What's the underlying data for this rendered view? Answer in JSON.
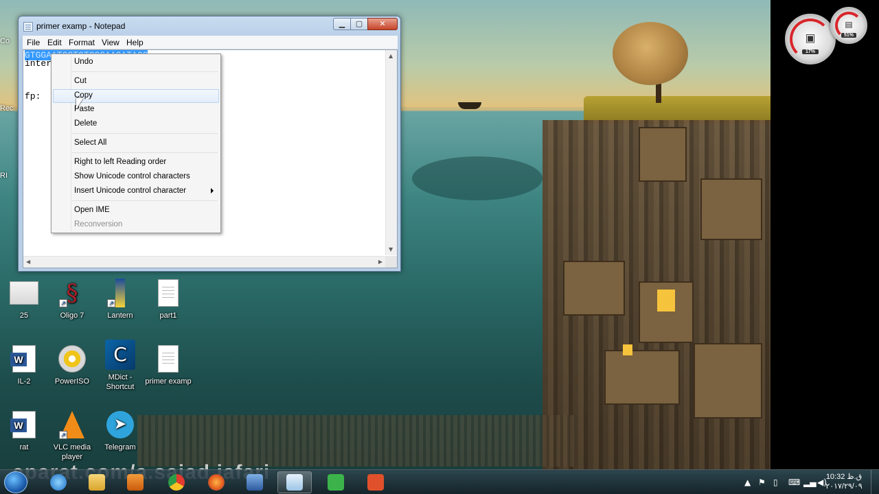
{
  "notepad": {
    "title": "primer examp - Notepad",
    "menu": [
      "File",
      "Edit",
      "Format",
      "View",
      "Help"
    ],
    "lines": [
      "GTGGAATGCTGTCGCAAGATAGG",
      "interf",
      "",
      "fp:  ~"
    ]
  },
  "context_menu": {
    "items": [
      {
        "label": "Undo"
      },
      {
        "label": "Cut"
      },
      {
        "label": "Copy",
        "highlighted": true
      },
      {
        "label": "Paste"
      },
      {
        "label": "Delete"
      },
      {
        "label": "Select All"
      },
      {
        "label": "Right to left Reading order"
      },
      {
        "label": "Show Unicode control characters"
      },
      {
        "label": "Insert Unicode control character",
        "submenu": true
      },
      {
        "label": "Open IME"
      },
      {
        "label": "Reconversion",
        "disabled": true
      }
    ]
  },
  "desktop_icons": [
    {
      "label": "25",
      "icon": "thumbnail-icon"
    },
    {
      "label": "Oligo 7",
      "icon": "oligo-icon"
    },
    {
      "label": "Lantern",
      "icon": "lantern-icon"
    },
    {
      "label": "part1",
      "icon": "text-file-icon"
    },
    {
      "label": "IL-2",
      "icon": "word-doc-icon"
    },
    {
      "label": "PowerISO",
      "icon": "poweriso-icon"
    },
    {
      "label": "MDict - Shortcut",
      "icon": "mdict-icon"
    },
    {
      "label": "primer examp",
      "icon": "text-file-icon"
    },
    {
      "label": "rat",
      "icon": "word-doc-icon"
    },
    {
      "label": "VLC media player",
      "icon": "vlc-icon"
    },
    {
      "label": "Telegram",
      "icon": "telegram-icon"
    }
  ],
  "edge_labels": [
    "Co",
    "Rec",
    "RI"
  ],
  "gadget": {
    "cpu_percent": "17%",
    "ram_percent": "51%"
  },
  "watermark": "aparat.com/a.sajad.jafari",
  "taskbar": {
    "apps": [
      "internet-explorer-icon",
      "file-explorer-icon",
      "media-player-icon",
      "chrome-icon",
      "firefox-icon",
      "network-app-icon",
      "notepad-icon",
      "camtasia-green-icon",
      "camtasia-orange-icon"
    ]
  },
  "clock": {
    "time": "10:32 ق.ظ",
    "date": "۲۰۱۷/۲۹/۰۹"
  },
  "colors": {
    "selection": "#3399ff",
    "menu_highlight": "#e3edf9",
    "taskbar": "#1c3038"
  }
}
